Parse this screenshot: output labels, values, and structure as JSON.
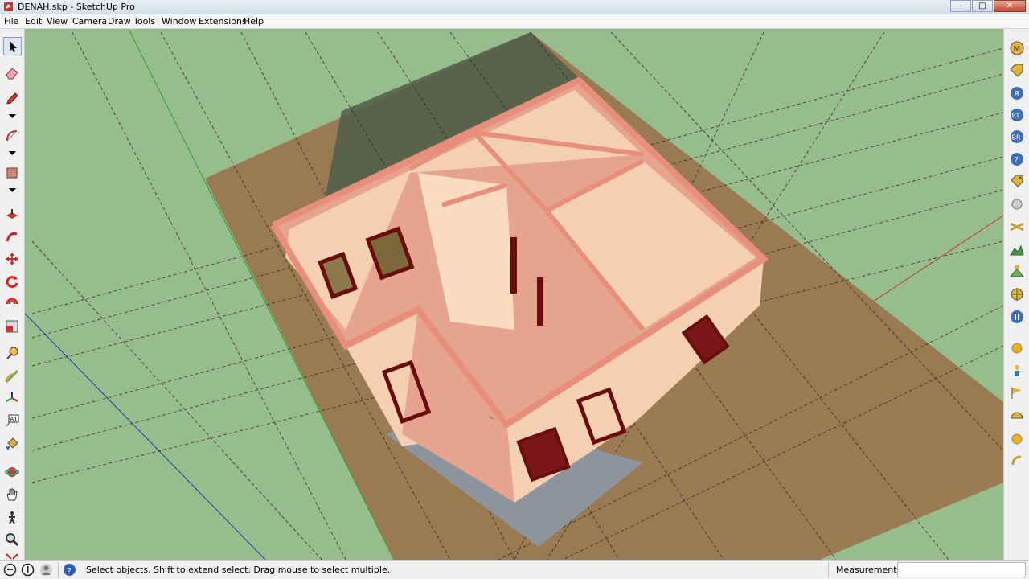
{
  "window": {
    "title": "DENAH.skp - SketchUp Pro",
    "minimize": "–",
    "maximize": "□",
    "close": "✕"
  },
  "menu": [
    "File",
    "Edit",
    "View",
    "Camera",
    "Draw",
    "Tools",
    "Window",
    "Extensions",
    "Help"
  ],
  "left_tools": [
    "select-tool",
    "eraser-tool",
    "line-tool",
    "arc-tool",
    "rectangle-tool",
    "push-pull-tool",
    "follow-me-tool",
    "move-tool",
    "rotate-tool",
    "offset-tool",
    "scale-tool",
    "tape-measure-tool",
    "protractor-tool",
    "axes-tool",
    "text-tool",
    "paint-bucket-tool",
    "orbit-tool",
    "pan-tool",
    "walk-tool",
    "zoom-tool"
  ],
  "right_tools": {
    "m": "M",
    "r": "R",
    "rt": "RT",
    "br": "BR",
    "help": "?"
  },
  "status": {
    "text": "Select objects. Shift to extend select. Drag mouse to select multiple.",
    "measurements_label": "Measurements",
    "measurements_value": ""
  },
  "colors": {
    "ground": "#98bd8d",
    "floor": "#9a7a52",
    "wall_interior": "#e6a48e",
    "wall_light": "#f5cfb1",
    "wall_top": "#e88e7c",
    "tile": "#8d949b",
    "frame": "#6b0c0c",
    "shadow": "#4f5e48"
  }
}
